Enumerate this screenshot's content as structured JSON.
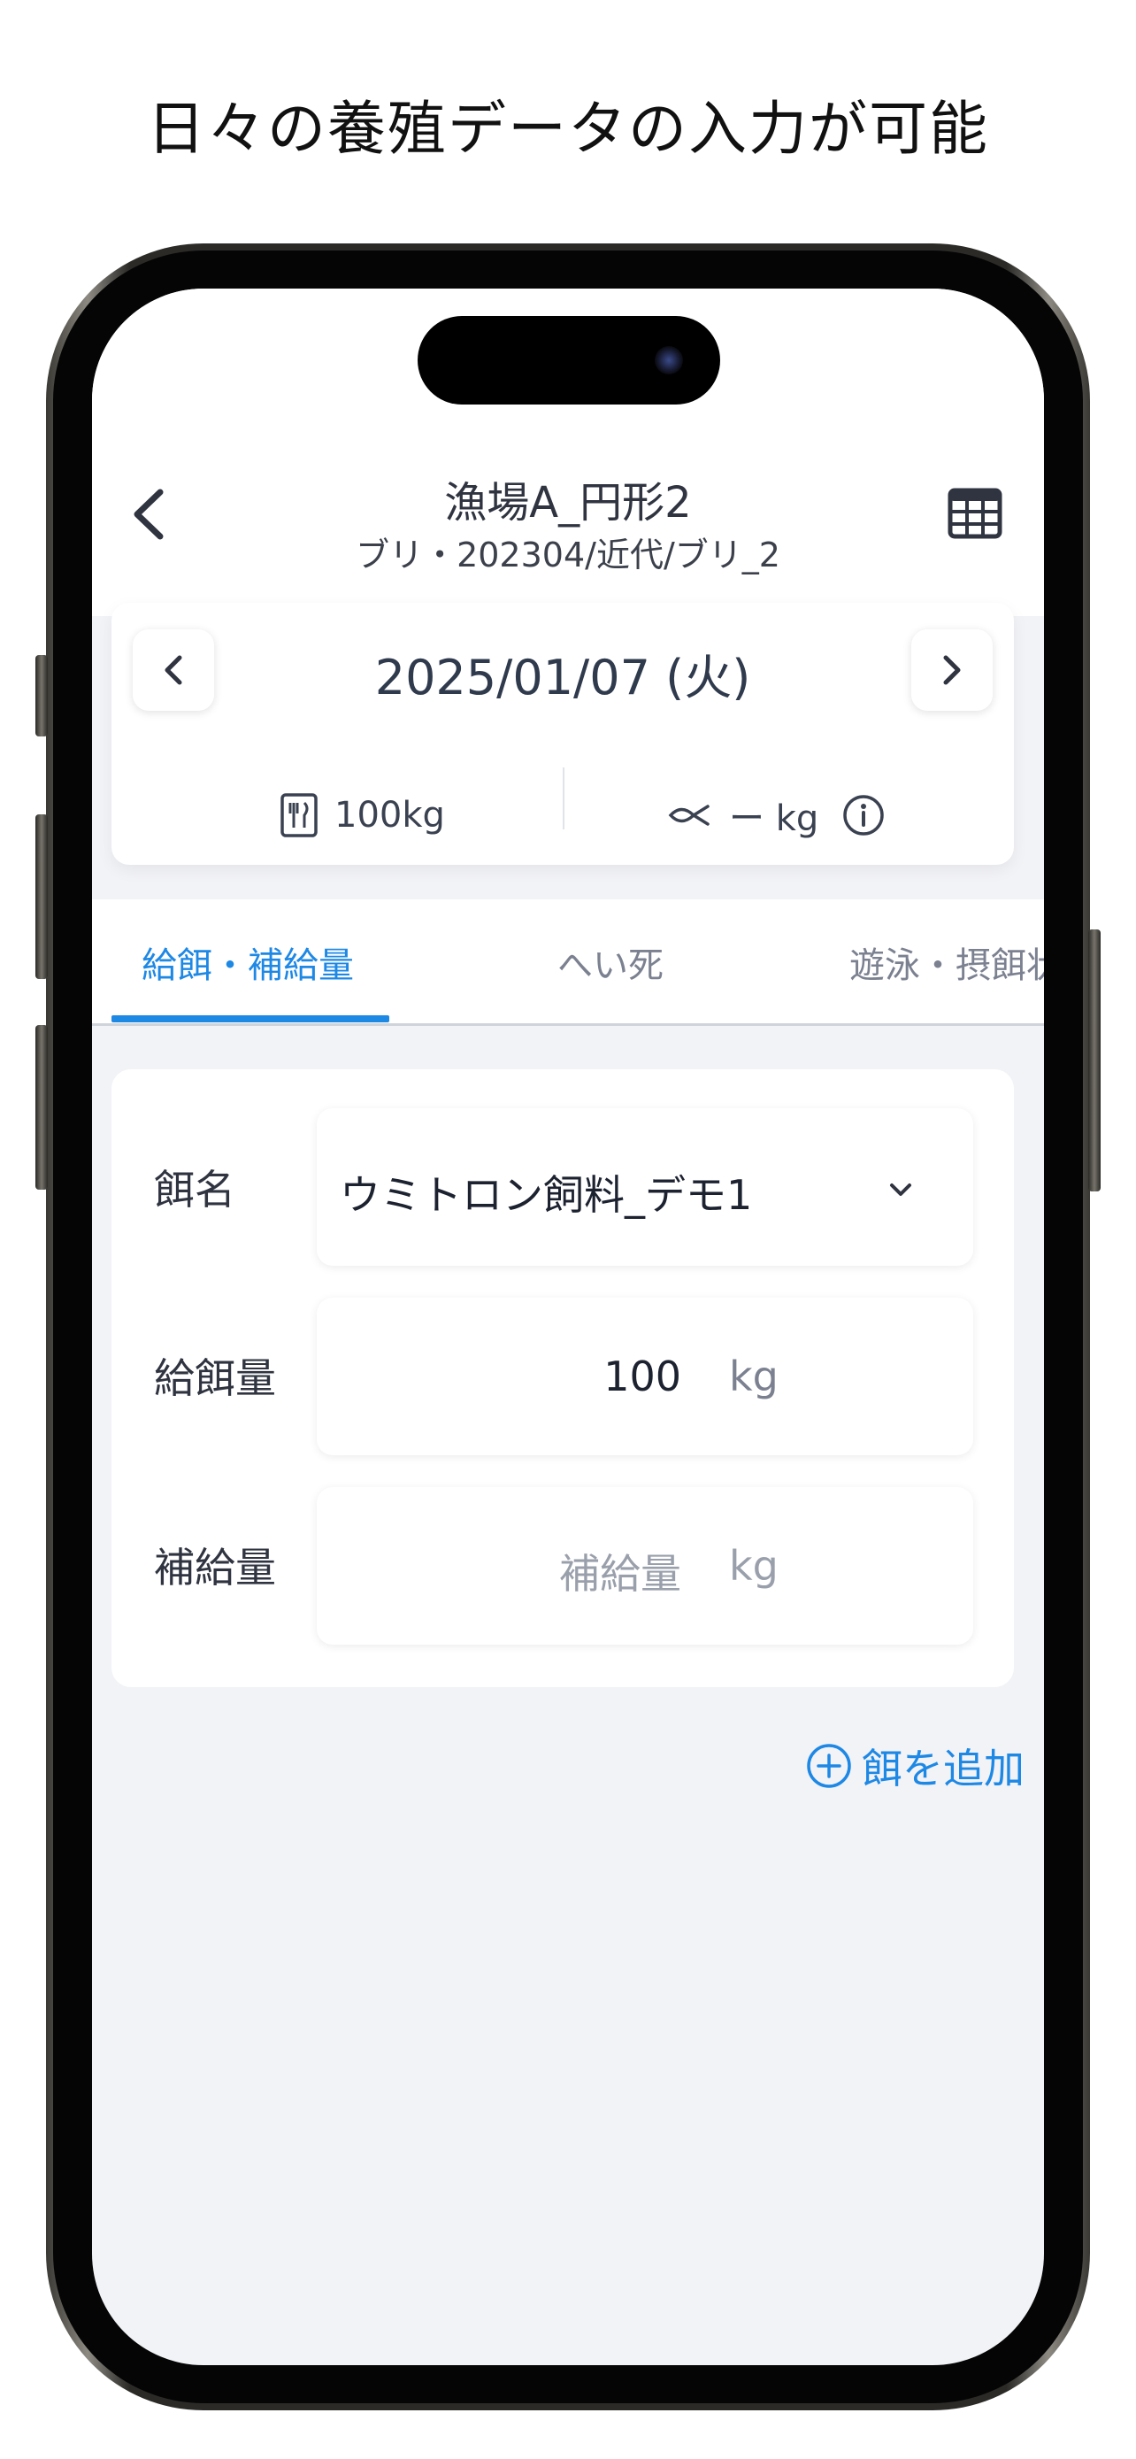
{
  "headline": "日々の養殖データの入力が可能",
  "header": {
    "title": "漁場A_円形2",
    "subtitle": "ブリ・202304/近代/ブリ_2"
  },
  "date_card": {
    "date": "2025/01/07 (火)",
    "feed_total": "100kg",
    "fish_weight": "ー kg"
  },
  "tabs": [
    {
      "label": "給餌・補給量",
      "active": true
    },
    {
      "label": "へい死",
      "active": false
    },
    {
      "label": "遊泳・摂餌状",
      "active": false
    }
  ],
  "form": {
    "feed_name_label": "餌名",
    "feed_name_value": "ウミトロン飼料_デモ1",
    "feed_amount_label": "給餌量",
    "feed_amount_value": "100",
    "feed_amount_unit": "kg",
    "supply_label": "補給量",
    "supply_placeholder": "補給量",
    "supply_unit": "kg"
  },
  "add_feed_label": "餌を追加",
  "colors": {
    "accent": "#1e88e5",
    "background": "#f2f3f7",
    "text": "#2f3440"
  }
}
